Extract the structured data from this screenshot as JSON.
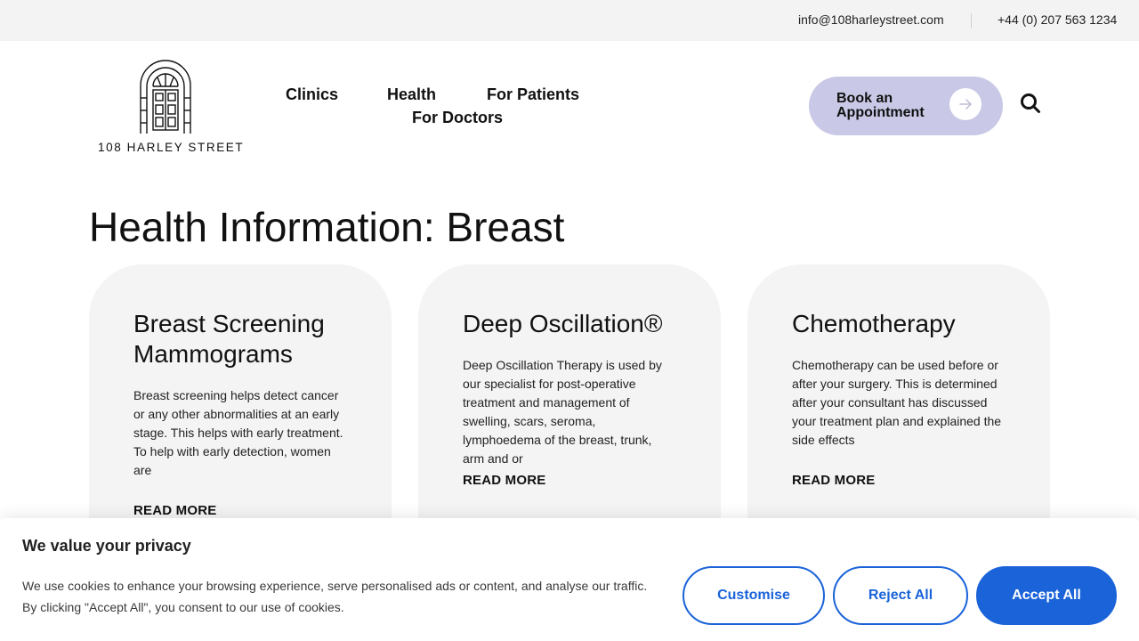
{
  "topbar": {
    "email": "info@108harleystreet.com",
    "phone": "+44 (0) 207 563 1234"
  },
  "logo": {
    "text": "108 HARLEY STREET"
  },
  "nav": {
    "items": [
      "Clinics",
      "Health",
      "For Patients",
      "For Doctors"
    ]
  },
  "header": {
    "book_label": "Book an Appointment",
    "icons": [
      "arrow-right-icon",
      "search-icon"
    ]
  },
  "main": {
    "title": "Health Information: Breast",
    "cards": [
      {
        "title": "Breast Screening Mammograms",
        "description": "Breast screening helps detect cancer or any other abnormalities at an early stage. This helps with early treatment. To help with early detection, women are",
        "link": "READ MORE"
      },
      {
        "title": "Deep Oscillation®",
        "description": "Deep Oscillation Therapy is used by our specialist for post-operative treatment and management of swelling, scars, seroma, lymphoedema of the breast, trunk, arm and or",
        "link": "READ MORE"
      },
      {
        "title": "Chemotherapy",
        "description": "Chemotherapy can be used before or after your surgery. This is determined after your consultant has discussed your treatment plan and explained the side effects",
        "link": "READ MORE"
      }
    ]
  },
  "cookie_banner": {
    "title": "We value your privacy",
    "text": "We use cookies to enhance your browsing experience, serve personalised ads or content, and analyse our traffic. By clicking \"Accept All\", you consent to our use of cookies.",
    "customise": "Customise",
    "reject": "Reject All",
    "accept": "Accept All"
  },
  "colors": {
    "accent_blue": "#1a63d9",
    "book_button": "#c9c8e6",
    "card_background": "#f4f4f4",
    "topbar_background": "#f3f3f3"
  }
}
